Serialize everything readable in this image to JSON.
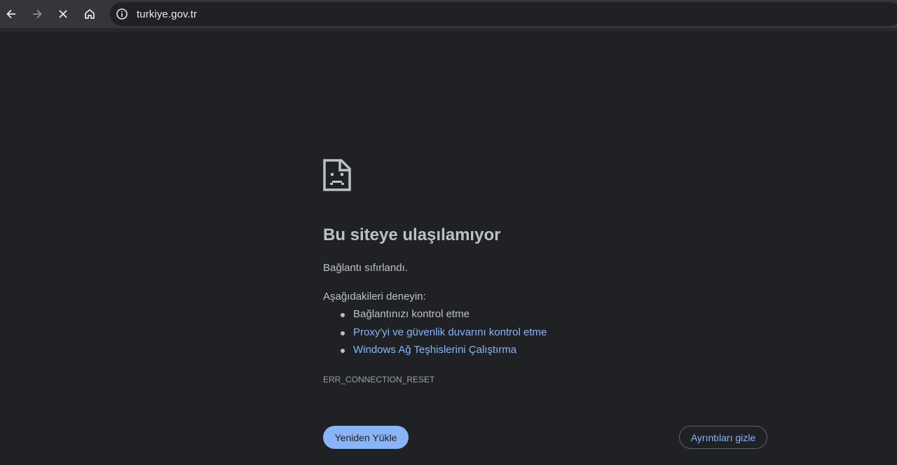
{
  "browser": {
    "url": "turkiye.gov.tr",
    "icons": {
      "back": "back-arrow-icon",
      "forward": "forward-arrow-icon",
      "stop": "close-icon",
      "home": "home-icon",
      "site_info": "info-icon"
    }
  },
  "error": {
    "icon": "sad-page-icon",
    "title": "Bu siteye ulaşılamıyor",
    "description": "Bağlantı sıfırlandı.",
    "try_heading": "Aşağıdakileri deneyin:",
    "suggestions": [
      {
        "label": "Bağlantınızı kontrol etme",
        "link": false
      },
      {
        "label": "Proxy'yi ve güvenlik duvarını kontrol etme",
        "link": true
      },
      {
        "label": "Windows Ağ Teşhislerini Çalıştırma",
        "link": true
      }
    ],
    "code": "ERR_CONNECTION_RESET",
    "reload_label": "Yeniden Yükle",
    "details_label": "Ayrıntıları gizle"
  },
  "colors": {
    "background": "#202124",
    "toolbar": "#35363a",
    "text": "#bdc1c6",
    "link": "#8ab4f8",
    "button_primary": "#8ab4f8"
  }
}
